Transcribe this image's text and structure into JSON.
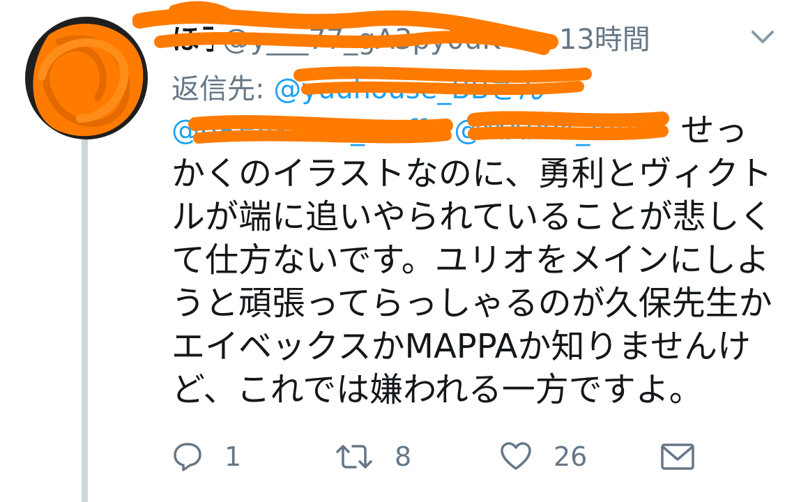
{
  "tweet": {
    "author_name": "ほ子",
    "handle": "@y___77_gA3py0uK",
    "separator": "·",
    "time": "13時間",
    "reply_to_label": "返信先:",
    "reply_to_mentions": [
      "@yuuhouse_BBさん",
      "@BREAKOUT_staff",
      "@MAPPA_Info"
    ],
    "text_lines": [
      "せっ",
      "かくのイラストなのに、勇利とヴィクト",
      "ルが端に追いやられていることが悲しく",
      "て仕方ないです。ユリオをメインにしよ",
      "うと頑張ってらっしゃるのが久保先生か",
      "エイベックスかMAPPAか知りませんけ",
      "ど、これでは嫌われる一方ですよ。"
    ]
  },
  "actions": {
    "reply_count": "1",
    "retweet_count": "8",
    "like_count": "26"
  },
  "icons": {
    "reply": "reply-icon",
    "retweet": "retweet-icon",
    "like": "heart-icon",
    "dm": "envelope-icon",
    "menu": "chevron-down-icon"
  },
  "colors": {
    "text": "#14171a",
    "secondary": "#657786",
    "mention": "#1da1f2",
    "thread_line": "#ccd6dd",
    "redaction": "#ff7b00"
  }
}
